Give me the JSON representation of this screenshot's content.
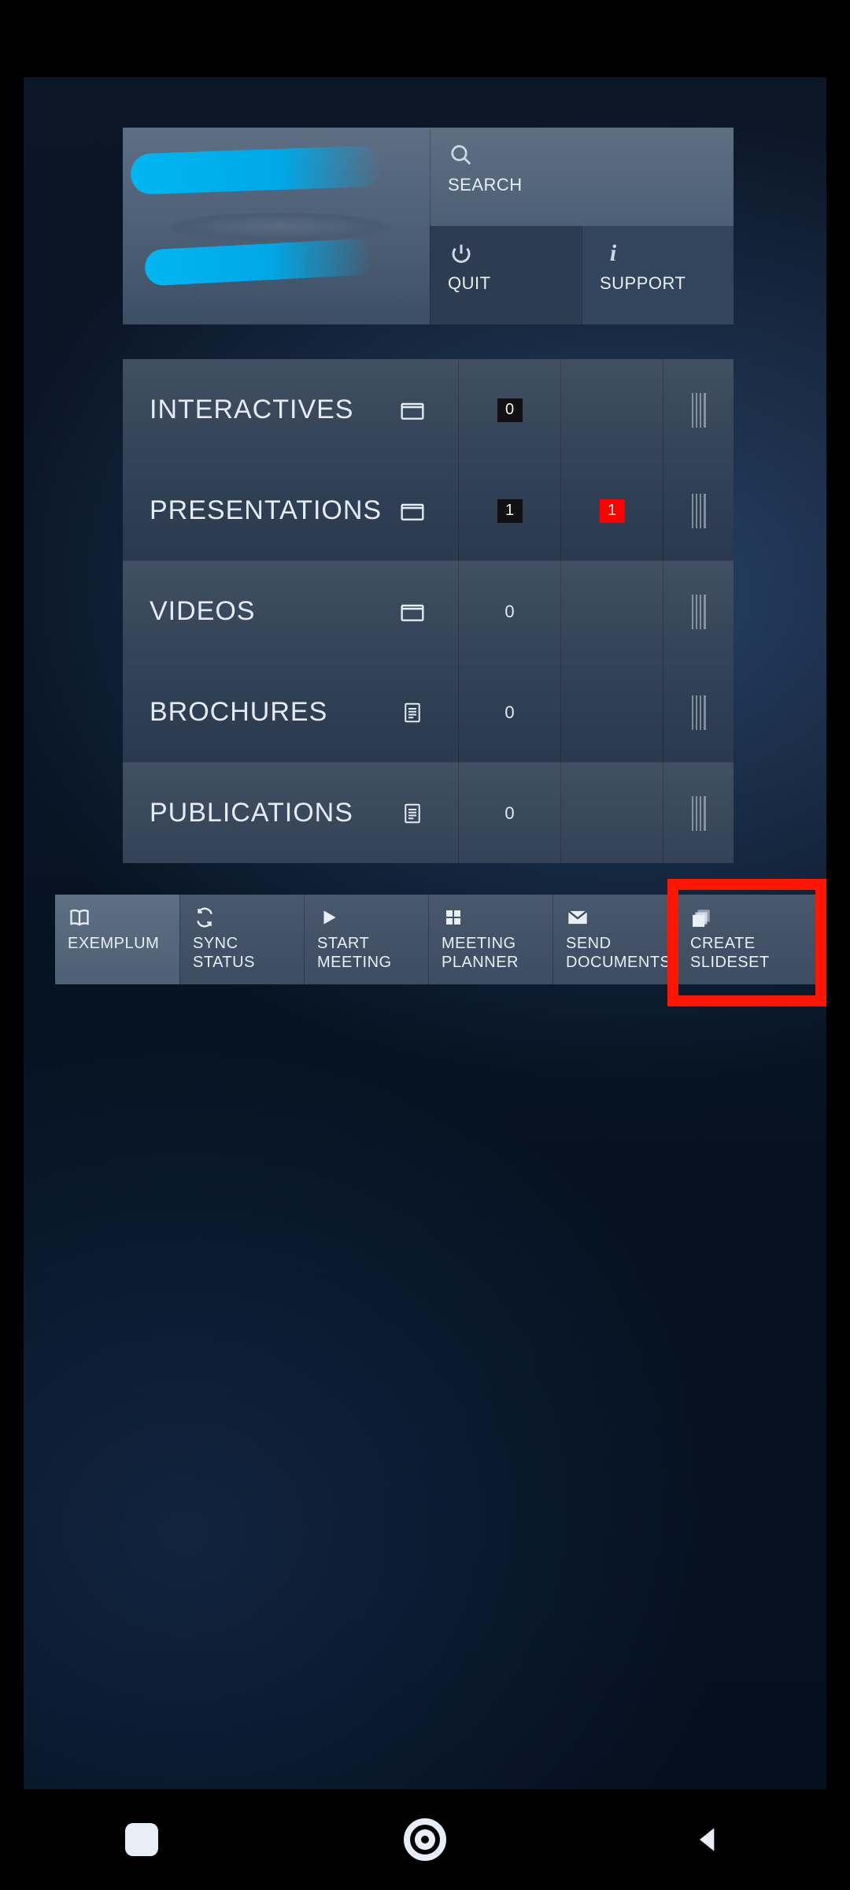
{
  "top": {
    "search_label": "SEARCH",
    "quit_label": "QUIT",
    "support_label": "SUPPORT"
  },
  "categories": [
    {
      "name": "INTERACTIVES",
      "icon": "folder",
      "count": "0",
      "count_style": "dark",
      "extra": null
    },
    {
      "name": "PRESENTATIONS",
      "icon": "folder",
      "count": "1",
      "count_style": "dark",
      "extra": "1"
    },
    {
      "name": "VIDEOS",
      "icon": "folder",
      "count": "0",
      "count_style": "plain",
      "extra": null
    },
    {
      "name": "BROCHURES",
      "icon": "document",
      "count": "0",
      "count_style": "plain",
      "extra": null
    },
    {
      "name": "PUBLICATIONS",
      "icon": "document",
      "count": "0",
      "count_style": "plain",
      "extra": null
    }
  ],
  "toolbar": [
    {
      "key": "exemplum",
      "label": "EXEMPLUM",
      "icon": "book"
    },
    {
      "key": "sync-status",
      "label": "SYNC STATUS",
      "icon": "sync"
    },
    {
      "key": "start-meeting",
      "label": "START\nMEETING",
      "icon": "play"
    },
    {
      "key": "meeting-planner",
      "label": "MEETING\nPLANNER",
      "icon": "grid"
    },
    {
      "key": "send-documents",
      "label": "SEND\nDOCUMENTS",
      "icon": "mail"
    },
    {
      "key": "create-slideset",
      "label": "CREATE\nSLIDESET",
      "icon": "stack"
    }
  ],
  "highlighted_toolbar_index": 5
}
